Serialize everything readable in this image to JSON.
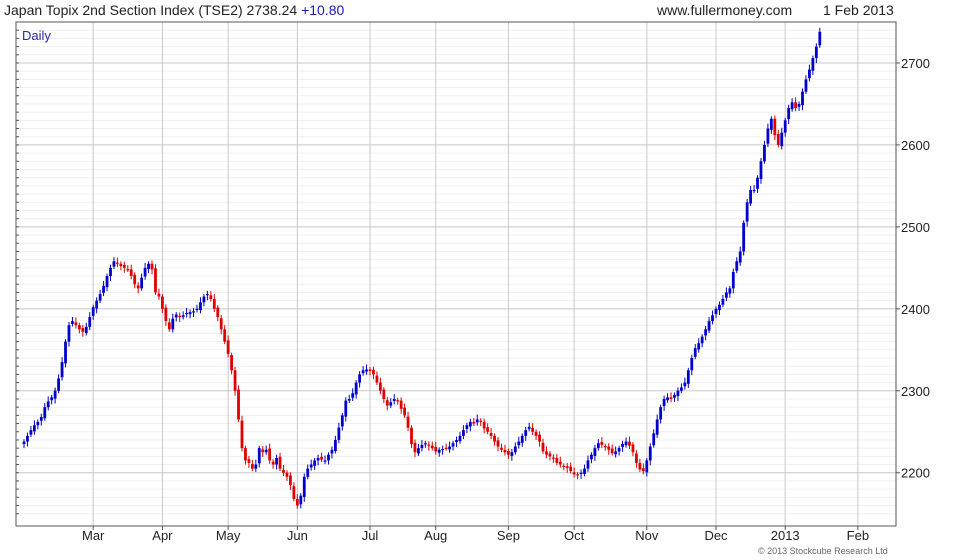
{
  "header": {
    "title": "Japan Topix 2nd Section Index (TSE2) 2738.24",
    "change": "+10.80",
    "site": "www.fullermoney.com",
    "date": "1 Feb 2013"
  },
  "footer": {
    "copyright": "© 2013 Stockcube Research Ltd"
  },
  "colors": {
    "up": "#0000cc",
    "down": "#e00000",
    "grid": "#c8c8c8",
    "axis": "#555555"
  },
  "chart_data": {
    "type": "candlestick",
    "period_label": "Daily",
    "ylim": [
      2135,
      2750
    ],
    "yticks": [
      2200,
      2300,
      2400,
      2500,
      2600,
      2700
    ],
    "xlim": [
      0,
      251
    ],
    "xticks": [
      {
        "label": "Mar",
        "x": 20
      },
      {
        "label": "Apr",
        "x": 40
      },
      {
        "label": "May",
        "x": 59
      },
      {
        "label": "Jun",
        "x": 79
      },
      {
        "label": "Jul",
        "x": 100
      },
      {
        "label": "Aug",
        "x": 119
      },
      {
        "label": "Sep",
        "x": 140
      },
      {
        "label": "Oct",
        "x": 159
      },
      {
        "label": "Nov",
        "x": 180
      },
      {
        "label": "Dec",
        "x": 200
      },
      {
        "label": "2013",
        "x": 220
      },
      {
        "label": "Feb",
        "x": 241
      }
    ],
    "legend": "none",
    "grid": true,
    "closes": [
      2238,
      2245,
      2252,
      2258,
      2262,
      2268,
      2280,
      2287,
      2292,
      2300,
      2315,
      2335,
      2360,
      2380,
      2385,
      2380,
      2375,
      2372,
      2378,
      2390,
      2402,
      2410,
      2418,
      2428,
      2440,
      2450,
      2458,
      2455,
      2452,
      2450,
      2448,
      2440,
      2430,
      2425,
      2438,
      2450,
      2455,
      2448,
      2420,
      2415,
      2400,
      2385,
      2375,
      2388,
      2393,
      2390,
      2392,
      2395,
      2396,
      2397,
      2400,
      2408,
      2415,
      2418,
      2412,
      2400,
      2390,
      2375,
      2360,
      2345,
      2325,
      2300,
      2265,
      2230,
      2215,
      2212,
      2205,
      2210,
      2230,
      2225,
      2228,
      2215,
      2210,
      2218,
      2205,
      2200,
      2195,
      2185,
      2168,
      2160,
      2172,
      2195,
      2205,
      2210,
      2215,
      2218,
      2216,
      2215,
      2222,
      2228,
      2240,
      2255,
      2270,
      2288,
      2290,
      2297,
      2310,
      2320,
      2325,
      2326,
      2324,
      2320,
      2310,
      2300,
      2290,
      2282,
      2286,
      2290,
      2288,
      2278,
      2270,
      2255,
      2235,
      2225,
      2230,
      2234,
      2236,
      2233,
      2230,
      2226,
      2228,
      2229,
      2230,
      2232,
      2236,
      2240,
      2245,
      2252,
      2258,
      2262,
      2260,
      2265,
      2262,
      2254,
      2250,
      2245,
      2238,
      2232,
      2228,
      2225,
      2222,
      2225,
      2232,
      2238,
      2245,
      2252,
      2256,
      2250,
      2245,
      2238,
      2226,
      2222,
      2220,
      2218,
      2212,
      2210,
      2208,
      2206,
      2202,
      2198,
      2197,
      2200,
      2205,
      2215,
      2222,
      2230,
      2236,
      2234,
      2232,
      2228,
      2224,
      2226,
      2230,
      2235,
      2238,
      2233,
      2225,
      2212,
      2204,
      2202,
      2215,
      2232,
      2248,
      2265,
      2280,
      2290,
      2292,
      2290,
      2295,
      2300,
      2304,
      2310,
      2325,
      2340,
      2352,
      2358,
      2366,
      2375,
      2385,
      2392,
      2400,
      2405,
      2412,
      2420,
      2425,
      2445,
      2458,
      2470,
      2505,
      2530,
      2545,
      2545,
      2560,
      2580,
      2600,
      2620,
      2632,
      2612,
      2600,
      2615,
      2630,
      2645,
      2652,
      2645,
      2650,
      2665,
      2680,
      2692,
      2706,
      2720,
      2738
    ]
  }
}
